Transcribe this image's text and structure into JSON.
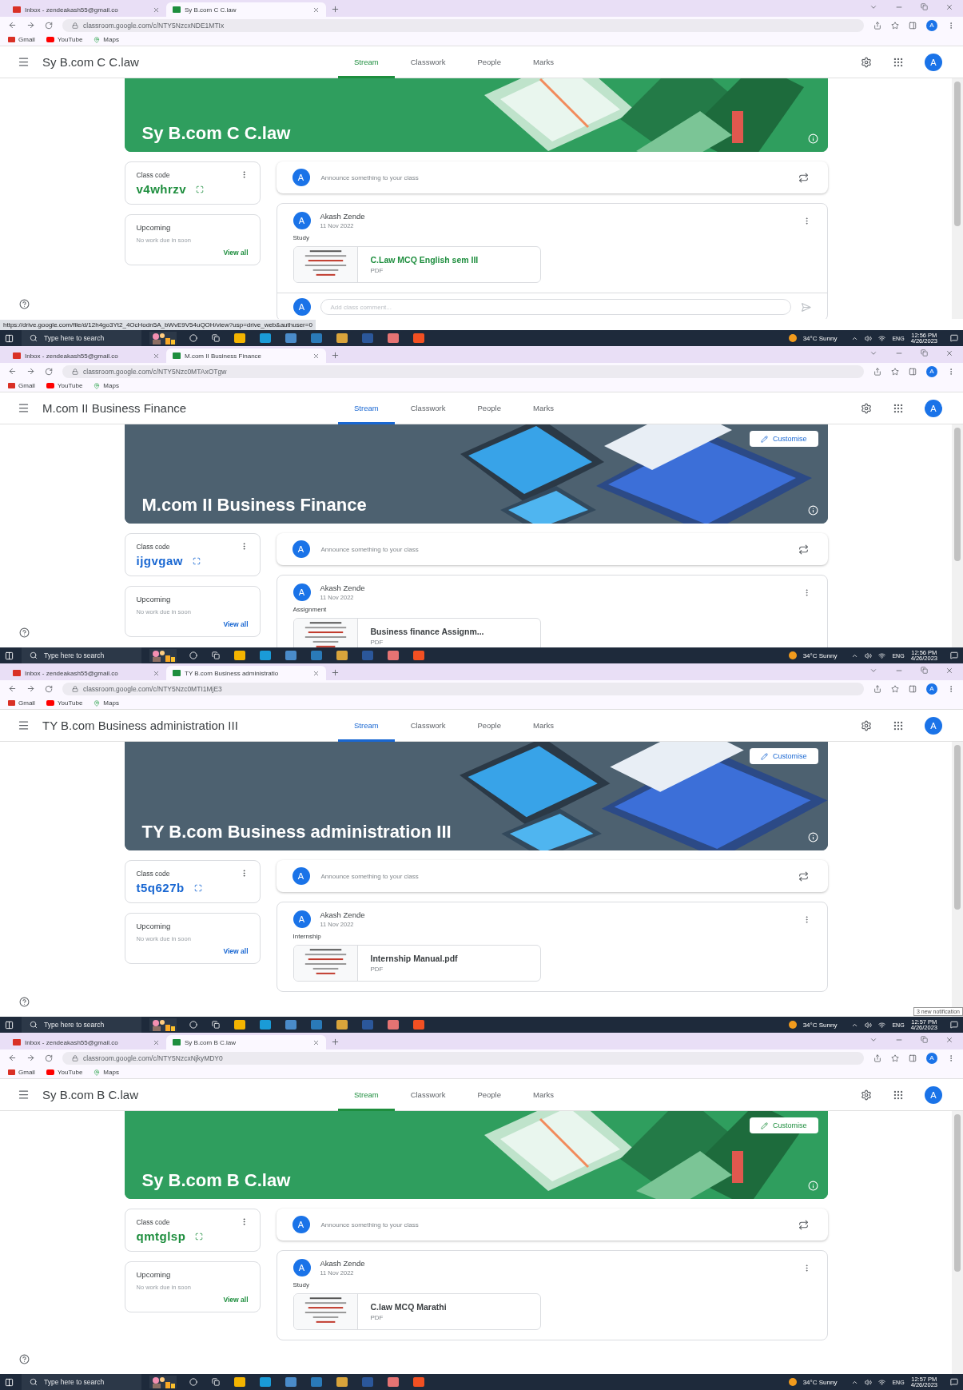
{
  "screens": [
    {
      "browser_tabs": [
        {
          "title": "Inbox - zendeakash55@gmail.co",
          "selected": false
        },
        {
          "title": "Sy B.com C C.law",
          "selected": true
        }
      ],
      "url": "classroom.google.com/c/NTY5NzcxNDE1MTIx",
      "profile": "A",
      "bookmarks": [
        "Gmail",
        "YouTube",
        "Maps"
      ],
      "class_name": "Sy B.com C C.law",
      "nav_tabs": [
        {
          "label": "Stream",
          "selected": true
        },
        {
          "label": "Classwork",
          "selected": false
        },
        {
          "label": "People",
          "selected": false
        },
        {
          "label": "Marks",
          "selected": false
        }
      ],
      "avatar": "A",
      "banner": {
        "title": "Sy B.com C C.law"
      },
      "class_code": {
        "label": "Class code",
        "code": "v4whrzv"
      },
      "upcoming": {
        "title": "Upcoming",
        "text": "No work due in soon",
        "link": "View all"
      },
      "announce": {
        "avatar": "A",
        "placeholder": "Announce something to your class"
      },
      "post": {
        "avatar": "A",
        "author": "Akash Zende",
        "date": "11 Nov 2022",
        "label": "Study",
        "attachment": {
          "title": "C.Law MCQ English sem III",
          "type": "PDF",
          "hovered": true
        }
      },
      "comment": {
        "avatar": "A",
        "placeholder": "Add class comment..."
      },
      "status_url": "https://drive.google.com/file/d/12h4go3Yt2_4OcHodn5A_bWvE9V54uQOH/view?usp=drive_web&authuser=0",
      "taskbar": {
        "search": "Type here to search",
        "weather": "34°C  Sunny",
        "lang": "ENG",
        "time": "12:56 PM",
        "date": "4/26/2023"
      }
    },
    {
      "browser_tabs": [
        {
          "title": "Inbox - zendeakash55@gmail.co",
          "selected": false
        },
        {
          "title": "M.com II Business Finance",
          "selected": true
        }
      ],
      "url": "classroom.google.com/c/NTY5Nzc0MTAxOTgw",
      "profile": "A",
      "bookmarks": [
        "Gmail",
        "YouTube",
        "Maps"
      ],
      "class_name": "M.com II Business Finance",
      "nav_tabs": [
        {
          "label": "Stream",
          "selected": true
        },
        {
          "label": "Classwork",
          "selected": false
        },
        {
          "label": "People",
          "selected": false
        },
        {
          "label": "Marks",
          "selected": false
        }
      ],
      "avatar": "A",
      "banner": {
        "title": "M.com II Business Finance",
        "customise": "Customise"
      },
      "class_code": {
        "label": "Class code",
        "code": "ijgvgaw"
      },
      "upcoming": {
        "title": "Upcoming",
        "text": "No work due in soon",
        "link": "View all"
      },
      "announce": {
        "avatar": "A",
        "placeholder": "Announce something to your class"
      },
      "post": {
        "avatar": "A",
        "author": "Akash Zende",
        "date": "11 Nov 2022",
        "label": "Assignment",
        "attachment": {
          "title": "Business finance Assignm...",
          "type": "PDF",
          "hovered": false
        }
      },
      "taskbar": {
        "search": "Type here to search",
        "weather": "34°C  Sunny",
        "lang": "ENG",
        "time": "12:56 PM",
        "date": "4/26/2023"
      }
    },
    {
      "browser_tabs": [
        {
          "title": "Inbox - zendeakash55@gmail.co",
          "selected": false
        },
        {
          "title": "TY B.com Business administratio",
          "selected": true
        }
      ],
      "url": "classroom.google.com/c/NTY5Nzc0MTI1MjE3",
      "profile": "A",
      "bookmarks": [
        "Gmail",
        "YouTube",
        "Maps"
      ],
      "class_name": "TY B.com Business administration III",
      "nav_tabs": [
        {
          "label": "Stream",
          "selected": true
        },
        {
          "label": "Classwork",
          "selected": false
        },
        {
          "label": "People",
          "selected": false
        },
        {
          "label": "Marks",
          "selected": false
        }
      ],
      "avatar": "A",
      "banner": {
        "title": "TY B.com Business administration III",
        "customise": "Customise"
      },
      "class_code": {
        "label": "Class code",
        "code": "t5q627b"
      },
      "upcoming": {
        "title": "Upcoming",
        "text": "No work due in soon",
        "link": "View all"
      },
      "announce": {
        "avatar": "A",
        "placeholder": "Announce something to your class"
      },
      "post": {
        "avatar": "A",
        "author": "Akash Zende",
        "date": "11 Nov 2022",
        "label": "Internship",
        "attachment": {
          "title": "Internship Manual.pdf",
          "type": "PDF",
          "hovered": false
        }
      },
      "notification": "3 new notification",
      "taskbar": {
        "search": "Type here to search",
        "weather": "34°C  Sunny",
        "lang": "ENG",
        "time": "12:57 PM",
        "date": "4/26/2023"
      }
    },
    {
      "browser_tabs": [
        {
          "title": "Inbox - zendeakash55@gmail.co",
          "selected": false
        },
        {
          "title": "Sy B.com B C.law",
          "selected": true
        }
      ],
      "url": "classroom.google.com/c/NTY5NzcxNjkyMDY0",
      "profile": "A",
      "bookmarks": [
        "Gmail",
        "YouTube",
        "Maps"
      ],
      "class_name": "Sy B.com B C.law",
      "nav_tabs": [
        {
          "label": "Stream",
          "selected": true
        },
        {
          "label": "Classwork",
          "selected": false
        },
        {
          "label": "People",
          "selected": false
        },
        {
          "label": "Marks",
          "selected": false
        }
      ],
      "avatar": "A",
      "banner": {
        "title": "Sy B.com B C.law",
        "customise": "Customise"
      },
      "class_code": {
        "label": "Class code",
        "code": "qmtglsp"
      },
      "upcoming": {
        "title": "Upcoming",
        "text": "No work due in soon",
        "link": "View all"
      },
      "announce": {
        "avatar": "A",
        "placeholder": "Announce something to your class"
      },
      "post": {
        "avatar": "A",
        "author": "Akash Zende",
        "date": "11 Nov 2022",
        "label": "Study",
        "attachment": {
          "title": "C.law MCQ Marathi",
          "type": "PDF",
          "hovered": false
        }
      },
      "taskbar": {
        "search": "Type here to search",
        "weather": "34°C  Sunny",
        "lang": "ENG",
        "time": "12:57 PM",
        "date": "4/26/2023"
      }
    }
  ]
}
